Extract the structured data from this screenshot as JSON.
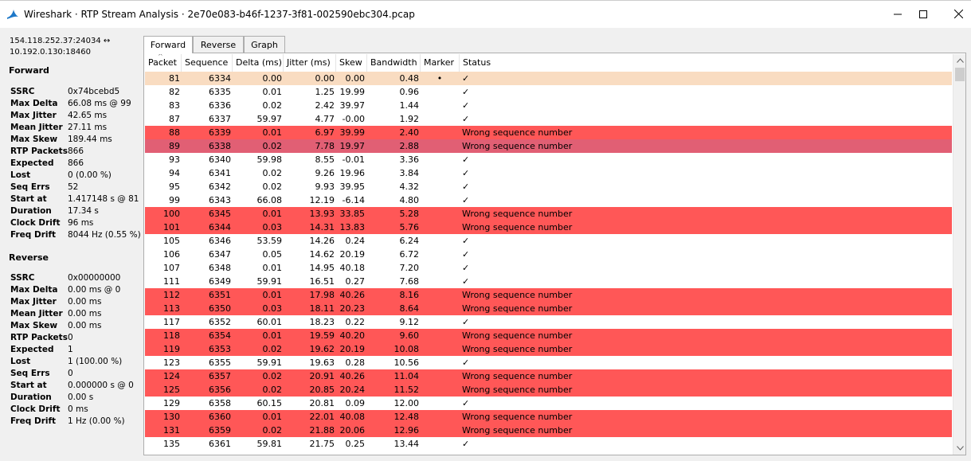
{
  "window": {
    "title": "Wireshark · RTP Stream Analysis · 2e70e083-b46f-1237-3f81-002590ebc304.pcap",
    "app_icon": "shark-fin-icon"
  },
  "stats": {
    "endpoints_line1": "154.118.252.37:24034 ↔",
    "endpoints_line2": "10.192.0.130:18460",
    "forward_title": "Forward",
    "forward": [
      {
        "label": "SSRC",
        "value": "0x74bcebd5"
      },
      {
        "label": "Max Delta",
        "value": "66.08 ms @ 99"
      },
      {
        "label": "Max Jitter",
        "value": "42.65 ms"
      },
      {
        "label": "Mean Jitter",
        "value": "27.11 ms"
      },
      {
        "label": "Max Skew",
        "value": "189.44 ms"
      },
      {
        "label": "RTP Packets",
        "value": "866"
      },
      {
        "label": "Expected",
        "value": "866"
      },
      {
        "label": "Lost",
        "value": "0 (0.00 %)"
      },
      {
        "label": "Seq Errs",
        "value": "52"
      },
      {
        "label": "Start at",
        "value": "1.417148 s @ 81"
      },
      {
        "label": "Duration",
        "value": "17.34 s"
      },
      {
        "label": "Clock Drift",
        "value": "96 ms"
      },
      {
        "label": "Freq Drift",
        "value": "8044 Hz (0.55 %)"
      }
    ],
    "reverse_title": "Reverse",
    "reverse": [
      {
        "label": "SSRC",
        "value": "0x00000000"
      },
      {
        "label": "Max Delta",
        "value": "0.00 ms @ 0"
      },
      {
        "label": "Max Jitter",
        "value": "0.00 ms"
      },
      {
        "label": "Mean Jitter",
        "value": "0.00 ms"
      },
      {
        "label": "Max Skew",
        "value": "0.00 ms"
      },
      {
        "label": "RTP Packets",
        "value": "0"
      },
      {
        "label": "Expected",
        "value": "1"
      },
      {
        "label": "Lost",
        "value": "1 (100.00 %)"
      },
      {
        "label": "Seq Errs",
        "value": "0"
      },
      {
        "label": "Start at",
        "value": "0.000000 s @ 0"
      },
      {
        "label": "Duration",
        "value": "0.00 s"
      },
      {
        "label": "Clock Drift",
        "value": "0 ms"
      },
      {
        "label": "Freq Drift",
        "value": "1 Hz (0.00 %)"
      }
    ]
  },
  "tabs": [
    {
      "label": "Forward",
      "active": true
    },
    {
      "label": "Reverse",
      "active": false
    },
    {
      "label": "Graph",
      "active": false
    }
  ],
  "table": {
    "columns": [
      "Packet",
      "Sequence",
      "Delta (ms)",
      "Jitter (ms)",
      "Skew",
      "Bandwidth",
      "Marker",
      "Status"
    ],
    "sort_indicator": "^",
    "ok_mark": "✓",
    "error_text": "Wrong sequence number",
    "colors": {
      "error_row": "#ff5757",
      "selected_row": "#f9dcc1",
      "error_selected_row": "#e15f74"
    },
    "rows": [
      {
        "packet": "81",
        "seq": "6334",
        "delta": "0.00",
        "jitter": "0.00",
        "skew": "0.00",
        "bw": "0.48",
        "marker": "•",
        "status": "✓",
        "state": "sel"
      },
      {
        "packet": "82",
        "seq": "6335",
        "delta": "0.01",
        "jitter": "1.25",
        "skew": "19.99",
        "bw": "0.96",
        "marker": "",
        "status": "✓",
        "state": "ok"
      },
      {
        "packet": "83",
        "seq": "6336",
        "delta": "0.02",
        "jitter": "2.42",
        "skew": "39.97",
        "bw": "1.44",
        "marker": "",
        "status": "✓",
        "state": "ok"
      },
      {
        "packet": "87",
        "seq": "6337",
        "delta": "59.97",
        "jitter": "4.77",
        "skew": "-0.00",
        "bw": "1.92",
        "marker": "",
        "status": "✓",
        "state": "ok"
      },
      {
        "packet": "88",
        "seq": "6339",
        "delta": "0.01",
        "jitter": "6.97",
        "skew": "39.99",
        "bw": "2.40",
        "marker": "",
        "status": "Wrong sequence number",
        "state": "err"
      },
      {
        "packet": "89",
        "seq": "6338",
        "delta": "0.02",
        "jitter": "7.78",
        "skew": "19.97",
        "bw": "2.88",
        "marker": "",
        "status": "Wrong sequence number",
        "state": "errsel"
      },
      {
        "packet": "93",
        "seq": "6340",
        "delta": "59.98",
        "jitter": "8.55",
        "skew": "-0.01",
        "bw": "3.36",
        "marker": "",
        "status": "✓",
        "state": "ok"
      },
      {
        "packet": "94",
        "seq": "6341",
        "delta": "0.02",
        "jitter": "9.26",
        "skew": "19.96",
        "bw": "3.84",
        "marker": "",
        "status": "✓",
        "state": "ok"
      },
      {
        "packet": "95",
        "seq": "6342",
        "delta": "0.02",
        "jitter": "9.93",
        "skew": "39.95",
        "bw": "4.32",
        "marker": "",
        "status": "✓",
        "state": "ok"
      },
      {
        "packet": "99",
        "seq": "6343",
        "delta": "66.08",
        "jitter": "12.19",
        "skew": "-6.14",
        "bw": "4.80",
        "marker": "",
        "status": "✓",
        "state": "ok"
      },
      {
        "packet": "100",
        "seq": "6345",
        "delta": "0.01",
        "jitter": "13.93",
        "skew": "33.85",
        "bw": "5.28",
        "marker": "",
        "status": "Wrong sequence number",
        "state": "err"
      },
      {
        "packet": "101",
        "seq": "6344",
        "delta": "0.03",
        "jitter": "14.31",
        "skew": "13.83",
        "bw": "5.76",
        "marker": "",
        "status": "Wrong sequence number",
        "state": "err"
      },
      {
        "packet": "105",
        "seq": "6346",
        "delta": "53.59",
        "jitter": "14.26",
        "skew": "0.24",
        "bw": "6.24",
        "marker": "",
        "status": "✓",
        "state": "ok"
      },
      {
        "packet": "106",
        "seq": "6347",
        "delta": "0.05",
        "jitter": "14.62",
        "skew": "20.19",
        "bw": "6.72",
        "marker": "",
        "status": "✓",
        "state": "ok"
      },
      {
        "packet": "107",
        "seq": "6348",
        "delta": "0.01",
        "jitter": "14.95",
        "skew": "40.18",
        "bw": "7.20",
        "marker": "",
        "status": "✓",
        "state": "ok"
      },
      {
        "packet": "111",
        "seq": "6349",
        "delta": "59.91",
        "jitter": "16.51",
        "skew": "0.27",
        "bw": "7.68",
        "marker": "",
        "status": "✓",
        "state": "ok"
      },
      {
        "packet": "112",
        "seq": "6351",
        "delta": "0.01",
        "jitter": "17.98",
        "skew": "40.26",
        "bw": "8.16",
        "marker": "",
        "status": "Wrong sequence number",
        "state": "err"
      },
      {
        "packet": "113",
        "seq": "6350",
        "delta": "0.03",
        "jitter": "18.11",
        "skew": "20.23",
        "bw": "8.64",
        "marker": "",
        "status": "Wrong sequence number",
        "state": "err"
      },
      {
        "packet": "117",
        "seq": "6352",
        "delta": "60.01",
        "jitter": "18.23",
        "skew": "0.22",
        "bw": "9.12",
        "marker": "",
        "status": "✓",
        "state": "ok"
      },
      {
        "packet": "118",
        "seq": "6354",
        "delta": "0.01",
        "jitter": "19.59",
        "skew": "40.20",
        "bw": "9.60",
        "marker": "",
        "status": "Wrong sequence number",
        "state": "err"
      },
      {
        "packet": "119",
        "seq": "6353",
        "delta": "0.02",
        "jitter": "19.62",
        "skew": "20.19",
        "bw": "10.08",
        "marker": "",
        "status": "Wrong sequence number",
        "state": "err"
      },
      {
        "packet": "123",
        "seq": "6355",
        "delta": "59.91",
        "jitter": "19.63",
        "skew": "0.28",
        "bw": "10.56",
        "marker": "",
        "status": "✓",
        "state": "ok"
      },
      {
        "packet": "124",
        "seq": "6357",
        "delta": "0.02",
        "jitter": "20.91",
        "skew": "40.26",
        "bw": "11.04",
        "marker": "",
        "status": "Wrong sequence number",
        "state": "err"
      },
      {
        "packet": "125",
        "seq": "6356",
        "delta": "0.02",
        "jitter": "20.85",
        "skew": "20.24",
        "bw": "11.52",
        "marker": "",
        "status": "Wrong sequence number",
        "state": "err"
      },
      {
        "packet": "129",
        "seq": "6358",
        "delta": "60.15",
        "jitter": "20.81",
        "skew": "0.09",
        "bw": "12.00",
        "marker": "",
        "status": "✓",
        "state": "ok"
      },
      {
        "packet": "130",
        "seq": "6360",
        "delta": "0.01",
        "jitter": "22.01",
        "skew": "40.08",
        "bw": "12.48",
        "marker": "",
        "status": "Wrong sequence number",
        "state": "err"
      },
      {
        "packet": "131",
        "seq": "6359",
        "delta": "0.02",
        "jitter": "21.88",
        "skew": "20.06",
        "bw": "12.96",
        "marker": "",
        "status": "Wrong sequence number",
        "state": "err"
      },
      {
        "packet": "135",
        "seq": "6361",
        "delta": "59.81",
        "jitter": "21.75",
        "skew": "0.25",
        "bw": "13.44",
        "marker": "",
        "status": "✓",
        "state": "ok"
      }
    ]
  }
}
